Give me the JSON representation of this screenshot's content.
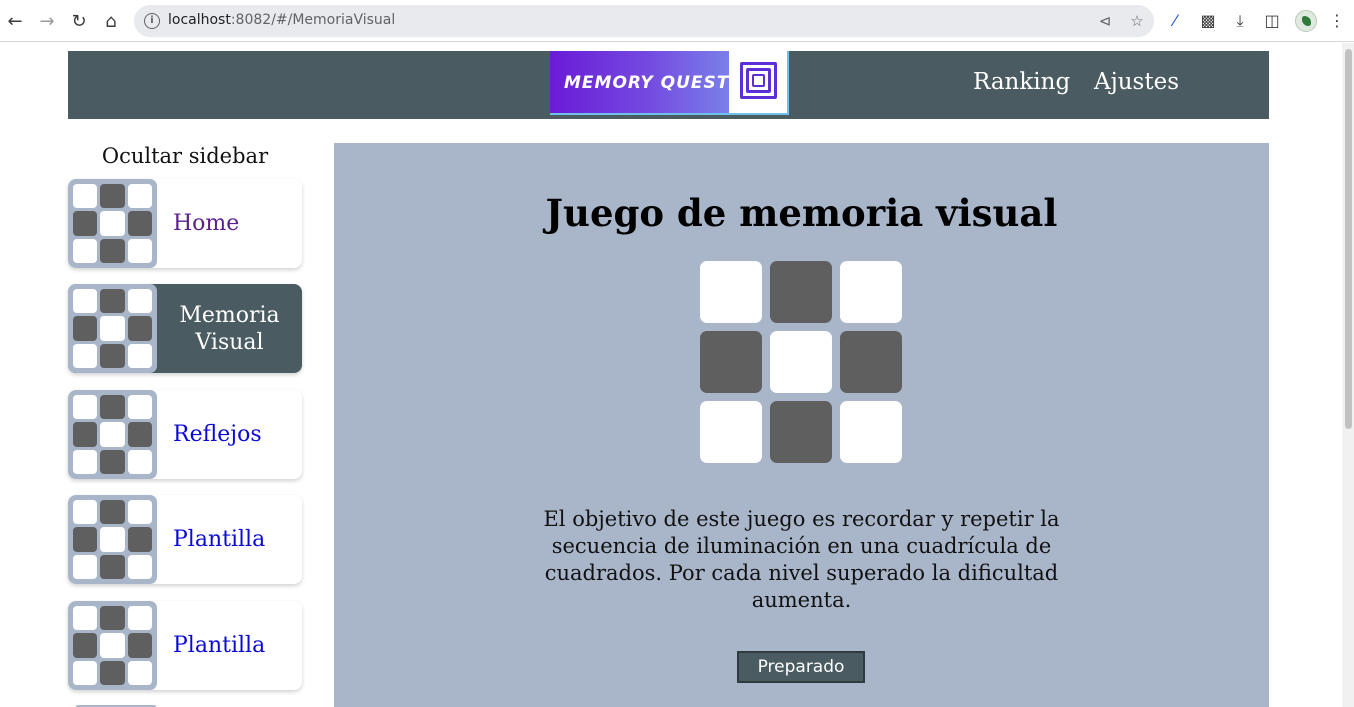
{
  "browser": {
    "url_host": "localhost",
    "url_rest": ":8082/#/MemoriaVisual"
  },
  "header": {
    "logo_text": "MEMORY QUEST",
    "nav": [
      {
        "label": "Ranking"
      },
      {
        "label": "Ajustes"
      }
    ]
  },
  "sidebar": {
    "toggle_label": "Ocultar sidebar",
    "items": [
      {
        "label": "Home",
        "state": "visited"
      },
      {
        "label": "Memoria Visual",
        "state": "active"
      },
      {
        "label": "Reflejos",
        "state": "link"
      },
      {
        "label": "Plantilla",
        "state": "link"
      },
      {
        "label": "Plantilla",
        "state": "link"
      }
    ]
  },
  "main": {
    "title": "Juego de memoria visual",
    "description": "El objetivo de este juego es recordar y repetir la secuencia de iluminación en una cuadrícula de cuadrados. Por cada nivel superado la dificultad aumenta.",
    "button_label": "Preparado",
    "grid_pattern": [
      "white",
      "dark",
      "white",
      "dark",
      "white",
      "dark",
      "white",
      "dark",
      "white"
    ]
  },
  "colors": {
    "header_bg": "#4a5c61",
    "panel_bg": "#a9b6ca",
    "tile_dark": "#5f5f5f",
    "link": "#0a0ad4",
    "visited_link": "#5a1f8f"
  }
}
